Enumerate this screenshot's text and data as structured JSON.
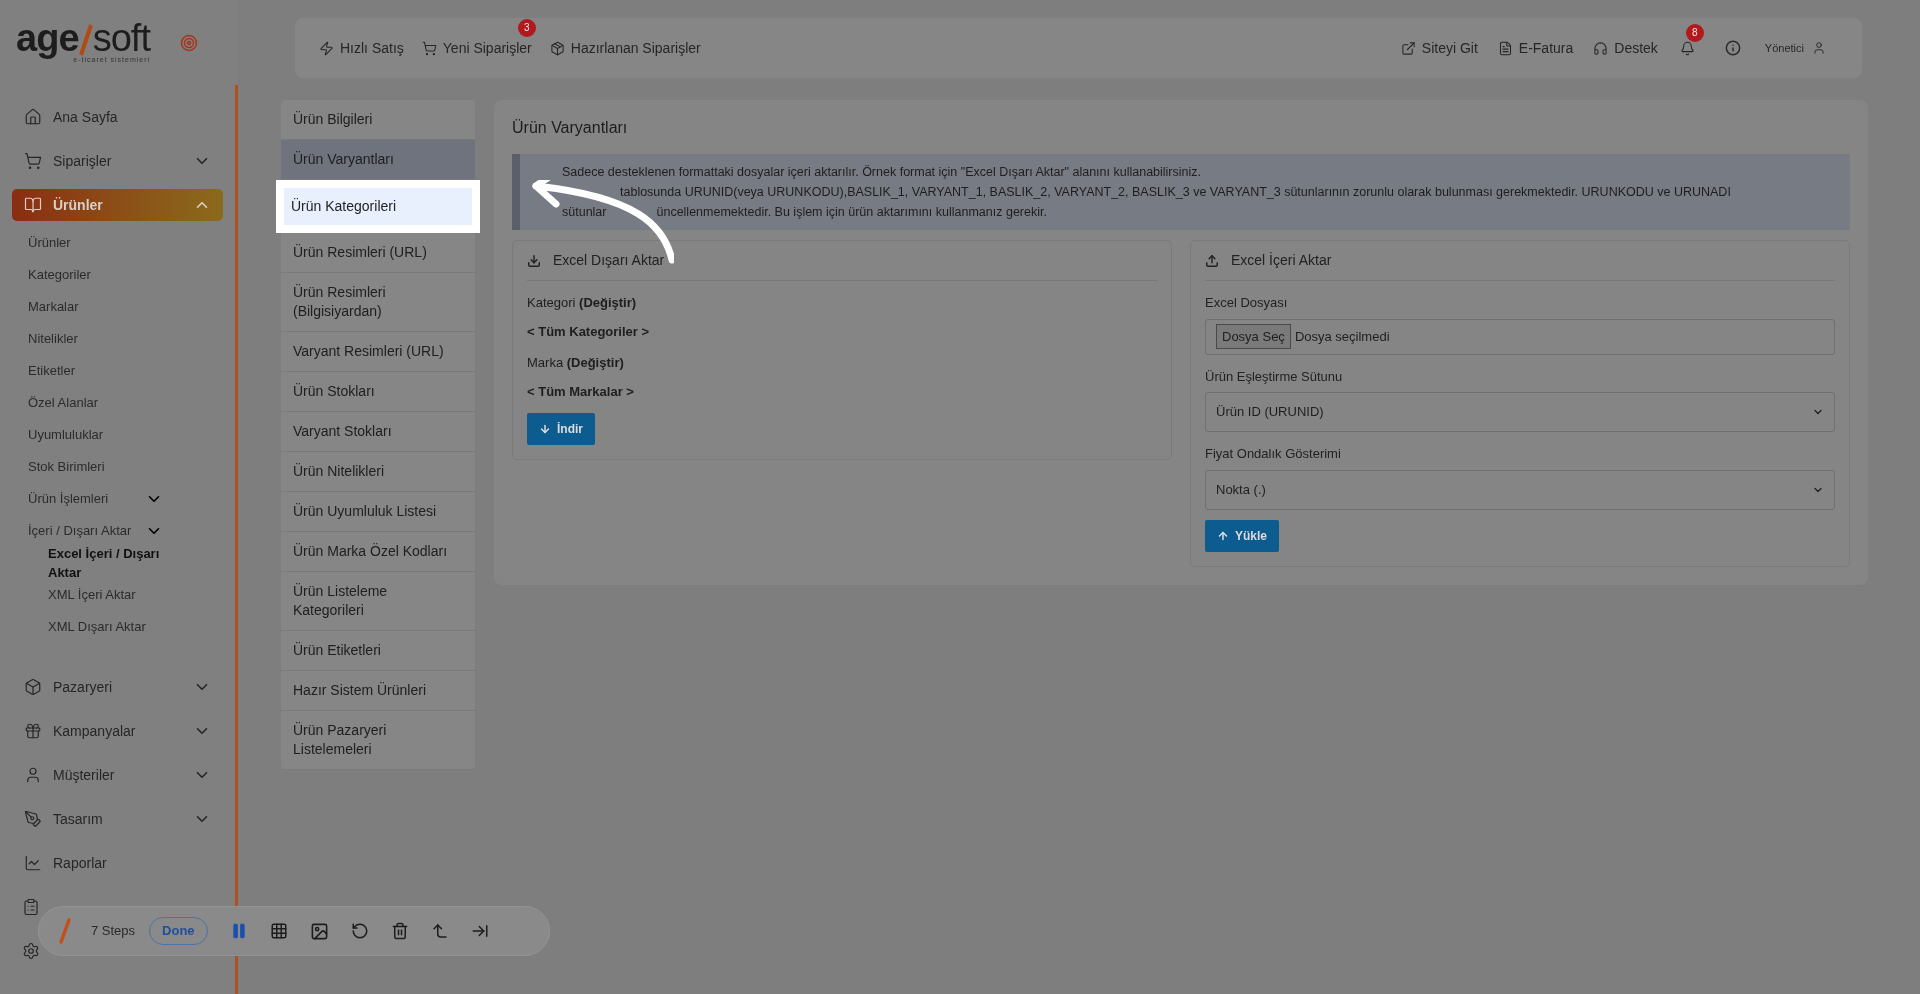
{
  "logo": {
    "left": "age",
    "right": "soft",
    "tagline": "e-ticaret sistemleri"
  },
  "sidebar": {
    "items": [
      {
        "label": "Ana Sayfa",
        "selected": false
      },
      {
        "label": "Siparişler",
        "selected": false,
        "expanded": false
      },
      {
        "label": "Ürünler",
        "selected": true,
        "expanded": true,
        "children": [
          {
            "label": "Ürünler",
            "selected": false
          },
          {
            "label": "Kategoriler",
            "selected": false
          },
          {
            "label": "Markalar",
            "selected": false
          },
          {
            "label": "Nitelikler",
            "selected": false
          },
          {
            "label": "Etiketler",
            "selected": false
          },
          {
            "label": "Özel Alanlar",
            "selected": false
          },
          {
            "label": "Uyumluluklar",
            "selected": false
          },
          {
            "label": "Stok Birimleri",
            "selected": false
          },
          {
            "label": "Ürün İşlemleri",
            "selected": false,
            "expanded": false
          },
          {
            "label": "İçeri / Dışarı Aktar",
            "selected": false,
            "expanded": false,
            "children": [
              {
                "label": "Excel İçeri / Dışarı Aktar",
                "selected": true
              },
              {
                "label": "XML İçeri Aktar",
                "selected": false
              },
              {
                "label": "XML Dışarı Aktar",
                "selected": false
              }
            ]
          }
        ]
      },
      {
        "label": "Pazaryeri",
        "selected": false,
        "expanded": false
      },
      {
        "label": "Kampanyalar",
        "selected": false,
        "expanded": false
      },
      {
        "label": "Müşteriler",
        "selected": false,
        "expanded": false
      },
      {
        "label": "Tasarım",
        "selected": false,
        "expanded": false
      },
      {
        "label": "Raporlar",
        "selected": false
      },
      {
        "selected": false
      },
      {
        "selected": false
      }
    ]
  },
  "topbar": {
    "left": [
      {
        "label": "Hızlı Satış"
      },
      {
        "label": "Yeni Siparişler",
        "badge": "3"
      },
      {
        "label": "Hazırlanan Siparişler"
      }
    ],
    "right": [
      {
        "label": "Siteyi Git"
      },
      {
        "label": "E-Fatura"
      },
      {
        "label": "Destek"
      }
    ],
    "notifications": "8",
    "user": "Yönetici"
  },
  "submenu": [
    {
      "label": "Ürün Bilgileri",
      "selected": false,
      "spotlit": false
    },
    {
      "label": "Ürün Varyantları",
      "selected": true,
      "spotlit": false
    },
    {
      "label": "Ürün Kategorileri",
      "selected": false,
      "spotlit": true
    },
    {
      "label": "Ürün Resimleri (URL)",
      "selected": false,
      "spotlit": false
    },
    {
      "label": "Ürün Resimleri (Bilgisiyardan)",
      "selected": false,
      "spotlit": false
    },
    {
      "label": "Varyant Resimleri (URL)",
      "selected": false,
      "spotlit": false
    },
    {
      "label": "Ürün Stokları",
      "selected": false,
      "spotlit": false
    },
    {
      "label": "Varyant Stokları",
      "selected": false,
      "spotlit": false
    },
    {
      "label": "Ürün Nitelikleri",
      "selected": false,
      "spotlit": false
    },
    {
      "label": "Ürün Uyumluluk Listesi",
      "selected": false,
      "spotlit": false
    },
    {
      "label": "Ürün Marka Özel Kodları",
      "selected": false,
      "spotlit": false
    },
    {
      "label": "Ürün Listeleme Kategorileri",
      "selected": false,
      "spotlit": false
    },
    {
      "label": "Ürün Etiketleri",
      "selected": false,
      "spotlit": false
    },
    {
      "label": "Hazır Sistem Ürünleri",
      "selected": false,
      "spotlit": false
    },
    {
      "label": "Ürün Pazaryeri Listelemeleri",
      "selected": false,
      "spotlit": false
    }
  ],
  "main": {
    "title": "Ürün Varyantları",
    "info": [
      {
        "lead_covered": false,
        "parts": [
          "Sadece desteklenen formattaki dosyalar içeri aktarılır. Örnek format için \"Excel Dışarı Aktar\" alanını kullanabilirsiniz."
        ]
      },
      {
        "lead_covered": true,
        "parts": [
          "tablosunda URUNID(veya URUNKODU),BASLIK_1, VARYANT_1, BASLIK_2, VARYANT_2, BASLIK_3 ve VARYANT_3 sütunlarının zorunlu olarak bulunması gerekmektedir. URUNKODU ve URUNADI"
        ]
      },
      {
        "lead_covered": false,
        "parts": [
          "sütunlar",
          "üncellenmemektedir. Bu işlem için ürün aktarımını kullanmanız gerekir."
        ]
      }
    ],
    "export": {
      "title": "Excel Dışarı Aktar",
      "filters": [
        {
          "label": "Kategori **(Değiştir)**",
          "value": "< Tüm Kategoriler >"
        },
        {
          "label": "Marka **(Değiştir)**",
          "value": "< Tüm Markalar >"
        }
      ],
      "button": "İndir"
    },
    "import": {
      "title": "Excel İçeri Aktar",
      "file_label": "Excel Dosyası",
      "file_button": "Dosya Seç",
      "file_status": "Dosya seçilmedi",
      "selects": [
        {
          "label": "Ürün Eşleştirme Sütunu",
          "value": "Ürün ID (URUNID)"
        },
        {
          "label": "Fiyat Ondalık Gösterimi",
          "value": "Nokta (.)"
        }
      ],
      "button": "Yükle"
    }
  },
  "recorder": {
    "steps": "7 Steps",
    "done": "Done",
    "paused": false
  }
}
